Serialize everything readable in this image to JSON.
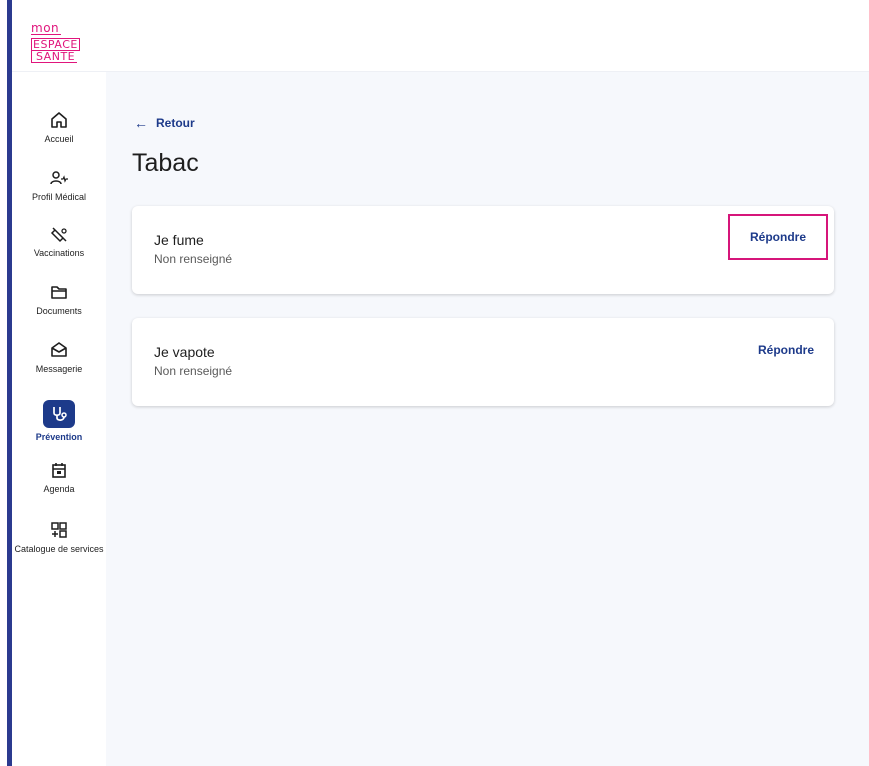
{
  "app": {
    "logo": {
      "line1": "mon",
      "line2": "ESPACE",
      "line3": "SANTE",
      "brand_color": "#e0157c"
    }
  },
  "sidebar": {
    "items": [
      {
        "label": "Accueil",
        "icon": "home-icon",
        "active": false
      },
      {
        "label": "Profil Médical",
        "icon": "medical-profile-icon",
        "active": false
      },
      {
        "label": "Vaccinations",
        "icon": "syringe-icon",
        "active": false
      },
      {
        "label": "Documents",
        "icon": "folder-icon",
        "active": false
      },
      {
        "label": "Messagerie",
        "icon": "envelope-icon",
        "active": false
      },
      {
        "label": "Prévention",
        "icon": "stethoscope-icon",
        "active": true
      },
      {
        "label": "Agenda",
        "icon": "calendar-icon",
        "active": false
      },
      {
        "label": "Catalogue de services",
        "icon": "apps-grid-icon",
        "active": false
      }
    ]
  },
  "main": {
    "back_label": "Retour",
    "back_icon": "arrow-left-icon",
    "title": "Tabac",
    "cards": [
      {
        "title": "Je fume",
        "status": "Non renseigné",
        "action": "Répondre",
        "highlighted": true
      },
      {
        "title": "Je vapote",
        "status": "Non renseigné",
        "action": "Répondre",
        "highlighted": false
      }
    ]
  },
  "colors": {
    "accent": "#1d3a8a",
    "highlight_border": "#d6157a",
    "background": "#f6f8fc"
  }
}
